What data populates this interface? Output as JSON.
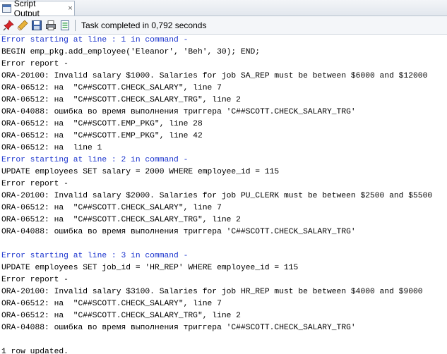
{
  "tab": {
    "label": "Script Output",
    "close": "×"
  },
  "toolbar": {
    "icons": [
      "pin-icon",
      "eraser-icon",
      "save-icon",
      "print-icon",
      "open-file-icon"
    ],
    "status": "Task completed in 0,792 seconds"
  },
  "output_lines": [
    {
      "text": "Error starting at line : 1 in command -",
      "kind": "header"
    },
    {
      "text": "BEGIN emp_pkg.add_employee('Eleanor', 'Beh', 30); END;",
      "kind": "plain"
    },
    {
      "text": "Error report -",
      "kind": "plain"
    },
    {
      "text": "ORA-20100: Invalid salary $1000. Salaries for job SA_REP must be between $6000 and $12000",
      "kind": "plain"
    },
    {
      "text": "ORA-06512: на  \"C##SCOTT.CHECK_SALARY\", line 7",
      "kind": "plain"
    },
    {
      "text": "ORA-06512: на  \"C##SCOTT.CHECK_SALARY_TRG\", line 2",
      "kind": "plain"
    },
    {
      "text": "ORA-04088: ошибка во время выполнения триггера 'C##SCOTT.CHECK_SALARY_TRG'",
      "kind": "plain"
    },
    {
      "text": "ORA-06512: на  \"C##SCOTT.EMP_PKG\", line 28",
      "kind": "plain"
    },
    {
      "text": "ORA-06512: на  \"C##SCOTT.EMP_PKG\", line 42",
      "kind": "plain"
    },
    {
      "text": "ORA-06512: на  line 1",
      "kind": "plain"
    },
    {
      "text": "Error starting at line : 2 in command -",
      "kind": "header"
    },
    {
      "text": "UPDATE employees SET salary = 2000 WHERE employee_id = 115",
      "kind": "plain"
    },
    {
      "text": "Error report -",
      "kind": "plain"
    },
    {
      "text": "ORA-20100: Invalid salary $2000. Salaries for job PU_CLERK must be between $2500 and $5500",
      "kind": "plain"
    },
    {
      "text": "ORA-06512: на  \"C##SCOTT.CHECK_SALARY\", line 7",
      "kind": "plain"
    },
    {
      "text": "ORA-06512: на  \"C##SCOTT.CHECK_SALARY_TRG\", line 2",
      "kind": "plain"
    },
    {
      "text": "ORA-04088: ошибка во время выполнения триггера 'C##SCOTT.CHECK_SALARY_TRG'",
      "kind": "plain"
    },
    {
      "text": "",
      "kind": "blank"
    },
    {
      "text": "Error starting at line : 3 in command -",
      "kind": "header"
    },
    {
      "text": "UPDATE employees SET job_id = 'HR_REP' WHERE employee_id = 115",
      "kind": "plain"
    },
    {
      "text": "Error report -",
      "kind": "plain"
    },
    {
      "text": "ORA-20100: Invalid salary $3100. Salaries for job HR_REP must be between $4000 and $9000",
      "kind": "plain"
    },
    {
      "text": "ORA-06512: на  \"C##SCOTT.CHECK_SALARY\", line 7",
      "kind": "plain"
    },
    {
      "text": "ORA-06512: на  \"C##SCOTT.CHECK_SALARY_TRG\", line 2",
      "kind": "plain"
    },
    {
      "text": "ORA-04088: ошибка во время выполнения триггера 'C##SCOTT.CHECK_SALARY_TRG'",
      "kind": "plain"
    },
    {
      "text": "",
      "kind": "blank"
    },
    {
      "text": "1 row updated.",
      "kind": "plain"
    }
  ]
}
